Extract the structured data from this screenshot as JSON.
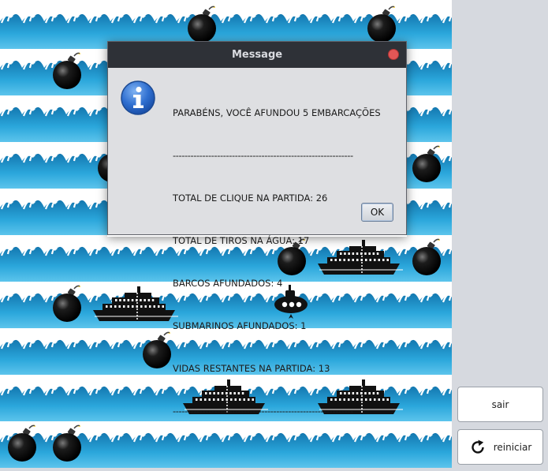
{
  "dialog": {
    "title": "Message",
    "heading": "PARABÉNS, VOCÊ AFUNDOU 5 EMBARCAÇÕES",
    "separator": "-------------------------------------------------------------",
    "stats": [
      "TOTAL DE CLIQUE NA PARTIDA: 26",
      "TOTAL DE TIROS NA ÁGUA: 17",
      "BARCOS AFUNDADOS: 4",
      "SUBMARINOS AFUNDADOS: 1",
      "VIDAS RESTANTES NA PARTIDA: 13"
    ],
    "ok_label": "OK",
    "icon": "info-icon"
  },
  "buttons": {
    "exit_label": "sair",
    "restart_label": "reiniciar",
    "restart_icon": "refresh-icon"
  },
  "board": {
    "columns": 10,
    "rows": [
      [
        {
          "col": 4,
          "item": "bomb"
        },
        {
          "col": 8,
          "item": "bomb"
        }
      ],
      [
        {
          "col": 1,
          "item": "bomb"
        }
      ],
      [],
      [
        {
          "col": 2,
          "item": "bomb"
        },
        {
          "col": 9,
          "item": "bomb"
        }
      ],
      [],
      [
        {
          "col": 6,
          "item": "bomb"
        },
        {
          "col": 7,
          "item": "ship"
        },
        {
          "col": 9,
          "item": "bomb"
        }
      ],
      [
        {
          "col": 1,
          "item": "bomb"
        },
        {
          "col": 2,
          "item": "ship"
        },
        {
          "col": 6,
          "item": "submarine"
        }
      ],
      [
        {
          "col": 3,
          "item": "bomb"
        }
      ],
      [
        {
          "col": 4,
          "item": "ship"
        },
        {
          "col": 7,
          "item": "ship"
        }
      ],
      [
        {
          "col": 0,
          "item": "bomb"
        },
        {
          "col": 1,
          "item": "bomb"
        }
      ]
    ]
  },
  "colors": {
    "water": "#2aa6db",
    "water_dark": "#1478b0",
    "foam": "#ffffff",
    "title_bar": "#2e3137",
    "close_button": "#e35656"
  }
}
